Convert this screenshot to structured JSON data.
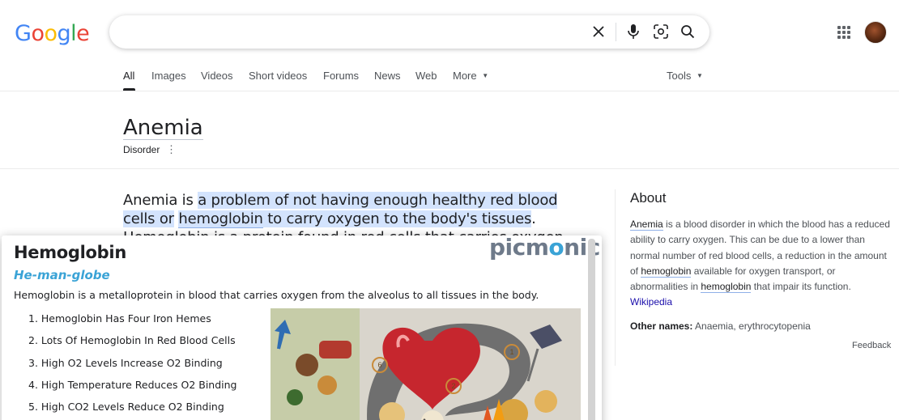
{
  "header": {
    "logo_letters": [
      {
        "ch": "G",
        "color": "#4285F4"
      },
      {
        "ch": "o",
        "color": "#EA4335"
      },
      {
        "ch": "o",
        "color": "#FBBC05"
      },
      {
        "ch": "g",
        "color": "#4285F4"
      },
      {
        "ch": "l",
        "color": "#34A853"
      },
      {
        "ch": "e",
        "color": "#EA4335"
      }
    ],
    "search": {
      "value": "",
      "placeholder": ""
    },
    "icons": [
      "clear-icon",
      "mic-icon",
      "lens-icon",
      "search-icon",
      "apps-icon",
      "avatar"
    ]
  },
  "tabs": [
    {
      "label": "All",
      "active": true
    },
    {
      "label": "Images"
    },
    {
      "label": "Videos"
    },
    {
      "label": "Short videos"
    },
    {
      "label": "Forums"
    },
    {
      "label": "News"
    },
    {
      "label": "Web"
    },
    {
      "label": "More"
    }
  ],
  "tools_label": "Tools",
  "entity": {
    "title": "Anemia",
    "subtitle": "Disorder"
  },
  "snippet": {
    "p1": "Anemia is ",
    "hl1": "a problem of not having enough healthy red blood cells or",
    "hl2": "hemoglobin",
    "hl3": " to carry oxygen to the body's tissues",
    "p2": ". ",
    "link": "Hemoglobin",
    "p3": " is a protein found in red cells that carries oxygen from the lungs to all other"
  },
  "about": {
    "title": "About",
    "t1": "Anemia",
    "t2": " is a blood disorder in which the blood has a reduced ability to carry oxygen. This can be due to a lower than normal number of red blood cells, a reduction in the amount of ",
    "t3": "hemoglobin",
    "t4": " available for oxygen transport, or abnormalities in ",
    "t5": "hemoglobin",
    "t6": " that impair its function.",
    "source": "Wikipedia",
    "other_label": "Other names:",
    "other_value": " Anaemia, erythrocytopenia",
    "feedback": "Feedback"
  },
  "card": {
    "title": "Hemoglobin",
    "subtitle": "He-man-globe",
    "description": "Hemoglobin is a metalloprotein in blood that carries oxygen from the alveolus to all tissues in the body.",
    "brand": "picmonic",
    "items": [
      "1. Hemoglobin Has Four Iron Hemes",
      "2. Lots Of Hemoglobin In Red Blood Cells",
      "3. High O2 Levels Increase O2 Binding",
      "4. High Temperature Reduces O2 Binding",
      "5. High CO2 Levels Reduce O2 Binding"
    ],
    "markers": [
      "1",
      "2",
      "6"
    ]
  }
}
